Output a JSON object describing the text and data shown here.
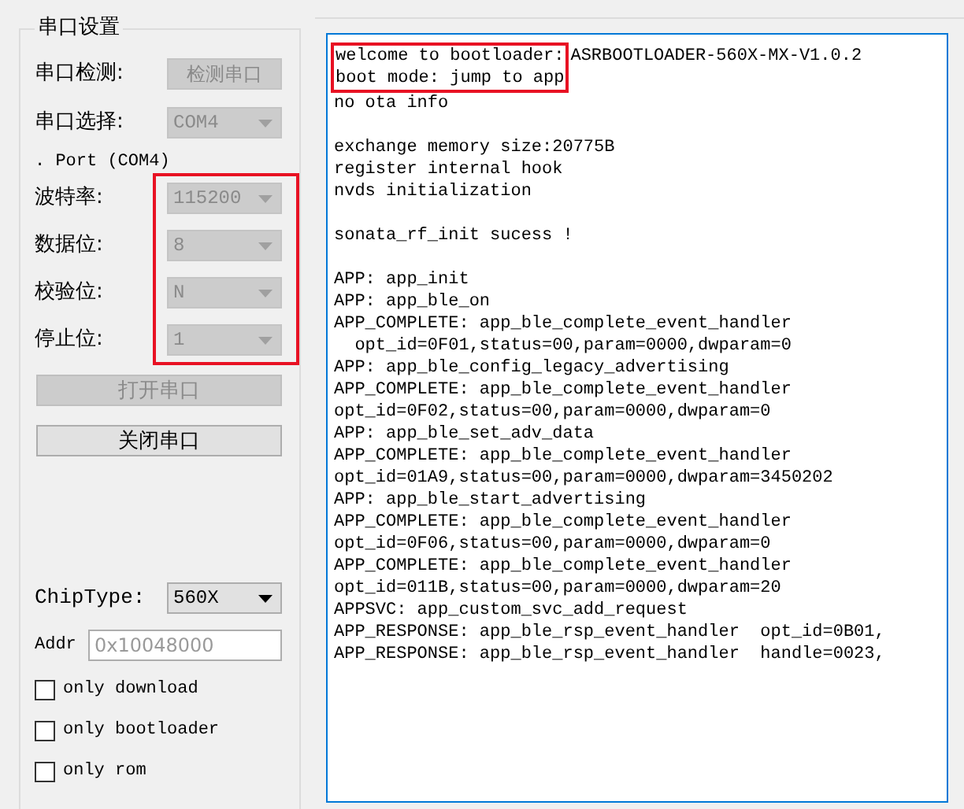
{
  "settings": {
    "title": "串口设置",
    "detect": {
      "label": "串口检测:",
      "button": "检测串口",
      "disabled": true
    },
    "port_select": {
      "label": "串口选择:",
      "value": "COM4",
      "disabled": true
    },
    "port_info": ". Port (COM4)",
    "params": {
      "highlighted": true,
      "items": [
        {
          "label": "波特率:",
          "value": "115200",
          "disabled": true
        },
        {
          "label": "数据位:",
          "value": "8",
          "disabled": true
        },
        {
          "label": "校验位:",
          "value": "N",
          "disabled": true
        },
        {
          "label": "停止位:",
          "value": "1",
          "disabled": true
        }
      ]
    },
    "buttons": [
      {
        "label": "打开串口",
        "disabled": true
      },
      {
        "label": "关闭串口",
        "disabled": false
      }
    ],
    "chip_type": {
      "label": "ChipType:",
      "value": "560X"
    },
    "addr": {
      "label": "Addr",
      "placeholder": "0x10048000"
    },
    "checkboxes": [
      {
        "label": "only download",
        "checked": false
      },
      {
        "label": "only bootloader",
        "checked": false
      },
      {
        "label": "only rom",
        "checked": false
      }
    ]
  },
  "log": {
    "header": {
      "highlighted": true,
      "lines": [
        "welcome to bootloader:",
        "boot mode: jump to app"
      ]
    },
    "header_suffix": "ASRBOOTLOADER-560X-MX-V1.0.2",
    "blocks": [
      [
        "no ota info"
      ],
      [
        "exchange memory size:20775B",
        "register internal hook",
        "nvds initialization"
      ],
      [
        "sonata_rf_init sucess !"
      ],
      [
        "APP: app_init",
        "APP: app_ble_on",
        "APP_COMPLETE: app_ble_complete_event_handler",
        "  opt_id=0F01,status=00,param=0000,dwparam=0",
        "APP: app_ble_config_legacy_advertising",
        "APP_COMPLETE: app_ble_complete_event_handler",
        "opt_id=0F02,status=00,param=0000,dwparam=0",
        "APP: app_ble_set_adv_data",
        "APP_COMPLETE: app_ble_complete_event_handler",
        "opt_id=01A9,status=00,param=0000,dwparam=3450202",
        "APP: app_ble_start_advertising",
        "APP_COMPLETE: app_ble_complete_event_handler",
        "opt_id=0F06,status=00,param=0000,dwparam=0",
        "APP_COMPLETE: app_ble_complete_event_handler",
        "opt_id=011B,status=00,param=0000,dwparam=20",
        "APPSVC: app_custom_svc_add_request",
        "APP_RESPONSE: app_ble_rsp_event_handler  opt_id=0B01,",
        "APP_RESPONSE: app_ble_rsp_event_handler  handle=0023,"
      ]
    ]
  }
}
